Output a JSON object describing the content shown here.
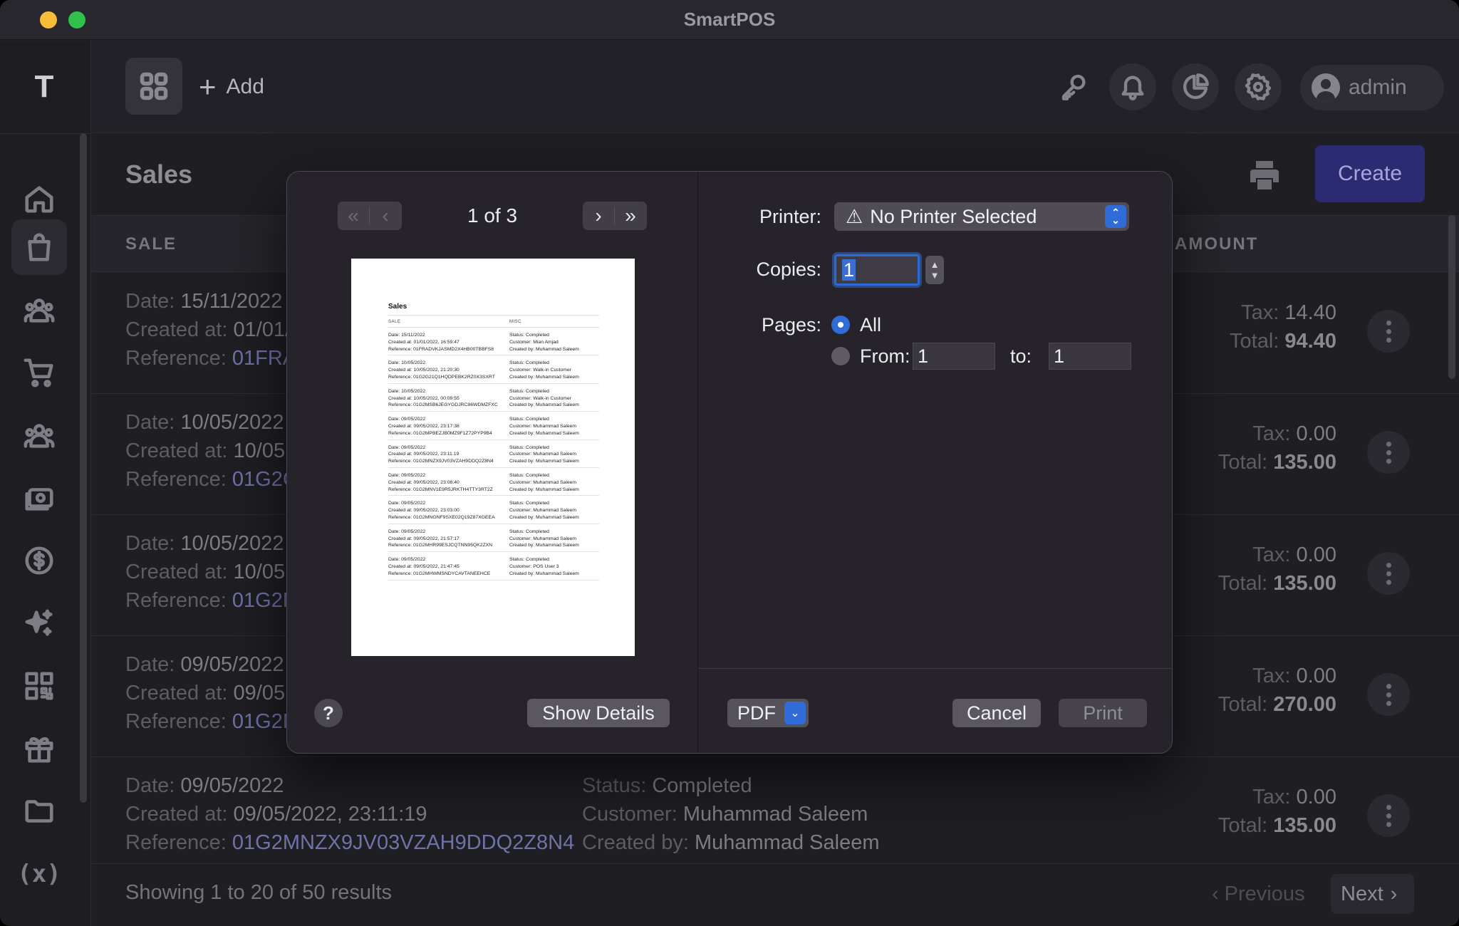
{
  "window": {
    "title": "SmartPOS"
  },
  "sidebar": {
    "logo": "T",
    "items": [
      {
        "name": "home"
      },
      {
        "name": "sales",
        "active": true
      },
      {
        "name": "customers"
      },
      {
        "name": "cart"
      },
      {
        "name": "users"
      },
      {
        "name": "cash-register"
      },
      {
        "name": "dollar"
      },
      {
        "name": "sparkles"
      },
      {
        "name": "qr-code"
      },
      {
        "name": "gift"
      },
      {
        "name": "folder"
      }
    ],
    "variables_label": "(x)"
  },
  "topbar": {
    "add_label": "Add",
    "user_label": "admin"
  },
  "page": {
    "title": "Sales",
    "create_label": "Create",
    "columns": {
      "sale": "SALE",
      "amount": "AMOUNT"
    },
    "labels": {
      "date": "Date:",
      "created": "Created at:",
      "reference": "Reference:",
      "status": "Status:",
      "customer": "Customer:",
      "created_by": "Created by:",
      "tax": "Tax:",
      "total": "Total:"
    },
    "rows": [
      {
        "date": "15/11/2022",
        "created": "01/01/",
        "reference": "01FRA",
        "tax": "14.40",
        "total": "94.40"
      },
      {
        "date": "10/05/2022",
        "created": "10/05",
        "reference": "01G2C",
        "tax": "0.00",
        "total": "135.00"
      },
      {
        "date": "10/05/2022",
        "created": "10/05",
        "reference": "01G2M",
        "tax": "0.00",
        "total": "135.00"
      },
      {
        "date": "09/05/2022",
        "created": "09/05",
        "reference": "01G2M",
        "tax": "0.00",
        "total": "270.00"
      },
      {
        "date": "09/05/2022",
        "created": "09/05/2022, 23:11:19",
        "reference": "01G2MNZX9JV03VZAH9DDQ2Z8N4",
        "status": "Completed",
        "customer": "Muhammad Saleem",
        "created_by": "Muhammad Saleem",
        "tax": "0.00",
        "total": "135.00"
      }
    ],
    "footer": {
      "showing": "Showing 1 to 20 of 50 results",
      "previous": "Previous",
      "next": "Next"
    }
  },
  "print_dialog": {
    "page_indicator": "1 of 3",
    "printer_label": "Printer:",
    "printer_value": "No Printer Selected",
    "copies_label": "Copies:",
    "copies_value": "1",
    "pages_label": "Pages:",
    "pages_all": "All",
    "pages_from": "From:",
    "pages_to": "to:",
    "from_value": "1",
    "to_value": "1",
    "help_label": "?",
    "show_details": "Show Details",
    "pdf_label": "PDF",
    "cancel": "Cancel",
    "print": "Print",
    "preview": {
      "title": "Sales",
      "col_sale": "SALE",
      "col_misc": "MISC",
      "rows": [
        {
          "date": "Date: 15/11/2022",
          "created": "Created at: 01/01/2022, 16:59:47",
          "reference": "Reference: 01FRADVKJASMD2X4HB00TBBFS8",
          "status": "Status: Completed",
          "customer": "Customer: Mian Amjad",
          "by": "Created by: Muhammad Saleem"
        },
        {
          "date": "Date: 10/05/2022",
          "created": "Created at: 10/05/2022, 21:20:30",
          "reference": "Reference: 01G2G21Q1HQDPEBK2RZ0X3SXRT",
          "status": "Status: Completed",
          "customer": "Customer: Walk-in Customer",
          "by": "Created by: Muhammad Saleem"
        },
        {
          "date": "Date: 10/05/2022",
          "created": "Created at: 10/05/2022, 00:09:55",
          "reference": "Reference: 01G2MSB6JEGYGDJRC86WDMZFXC",
          "status": "Status: Completed",
          "customer": "Customer: Walk-in Customer",
          "by": "Created by: Muhammad Saleem"
        },
        {
          "date": "Date: 09/05/2022",
          "created": "Created at: 09/05/2022, 23:17:38",
          "reference": "Reference: 01G2MPBEZJB0MZ9F1Z72PYP9B4",
          "status": "Status: Completed",
          "customer": "Customer: Muhammad Saleem",
          "by": "Created by: Muhammad Saleem"
        },
        {
          "date": "Date: 09/05/2022",
          "created": "Created at: 09/05/2022, 23:11:19",
          "reference": "Reference: 01G2MNZX9JV03VZAH9DDQ2Z8N4",
          "status": "Status: Completed",
          "customer": "Customer: Muhammad Saleem",
          "by": "Created by: Muhammad Saleem"
        },
        {
          "date": "Date: 09/05/2022",
          "created": "Created at: 09/05/2022, 23:08:40",
          "reference": "Reference: 01G2MNV1E9R5JRKTH4TTY3RT2Z",
          "status": "Status: Completed",
          "customer": "Customer: Muhammad Saleem",
          "by": "Created by: Muhammad Saleem"
        },
        {
          "date": "Date: 09/05/2022",
          "created": "Created at: 09/05/2022, 23:03:00",
          "reference": "Reference: 01G2MNGNF9SXE02Q19Z87XGEEA",
          "status": "Status: Completed",
          "customer": "Customer: Muhammad Saleem",
          "by": "Created by: Muhammad Saleem"
        },
        {
          "date": "Date: 09/05/2022",
          "created": "Created at: 09/05/2022, 21:57:17",
          "reference": "Reference: 01G2MHR99ESJCQTNN95QK2ZXN",
          "status": "Status: Completed",
          "customer": "Customer: Muhammad Saleem",
          "by": "Created by: Muhammad Saleem"
        },
        {
          "date": "Date: 09/05/2022",
          "created": "Created at: 09/05/2022, 21:47:45",
          "reference": "Reference: 01G2MHWMSNDYCAVTANEEHCE",
          "status": "Status: Completed",
          "customer": "Customer: POS User 3",
          "by": "Created by: Muhammad Saleem"
        }
      ]
    }
  },
  "colors": {
    "accent": "#2f6cd8",
    "create_button": "#2c2a73",
    "background": "#1f1e23",
    "dialog": "#26232b"
  }
}
